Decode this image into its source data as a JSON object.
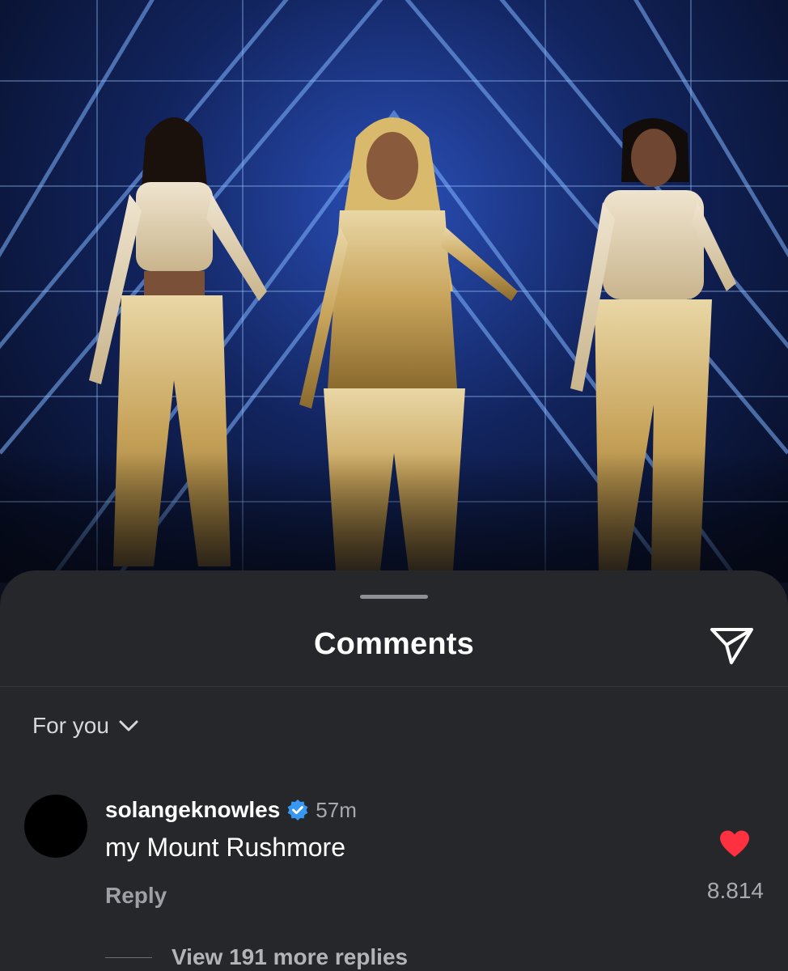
{
  "photo": {
    "subject": "three performers in gold outfits on stage"
  },
  "sheet": {
    "title": "Comments",
    "share_icon": "paper-plane-icon",
    "filter_label": "For you",
    "filter_icon": "chevron-down-icon"
  },
  "comments": [
    {
      "username": "solangeknowles",
      "verified": true,
      "time": "57m",
      "text": "my Mount Rushmore",
      "reply_label": "Reply",
      "liked": true,
      "like_count": "8.814",
      "more_replies_label": "View 191 more replies"
    }
  ],
  "colors": {
    "sheet_bg": "#25272b",
    "like_red": "#ff3040",
    "verified_blue": "#3897f0"
  }
}
